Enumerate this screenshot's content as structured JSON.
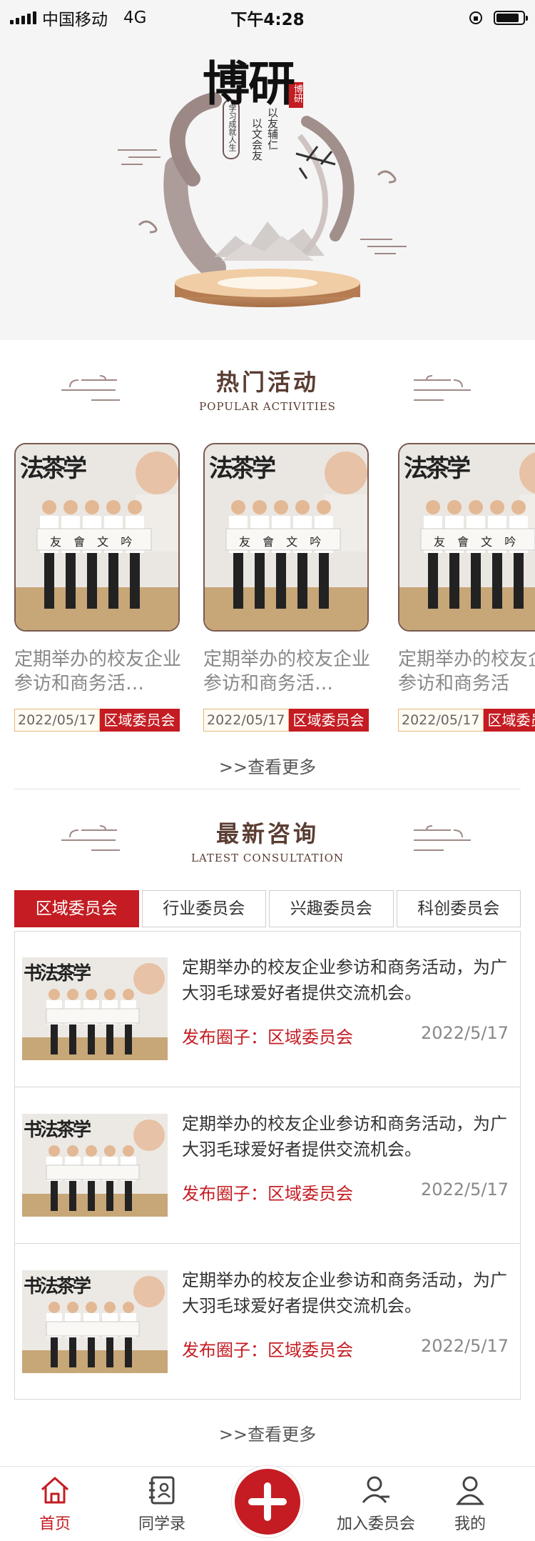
{
  "status_bar": {
    "carrier": "中国移动",
    "network": "4G",
    "time": "下午4:28",
    "battery_level": 0.85
  },
  "hero": {
    "calligraphy_main": "博研",
    "poem_line_1": "以友辅仁",
    "poem_line_2": "以文会友",
    "motto": "学习成就人生",
    "seal": "博研"
  },
  "popular": {
    "title": "热门活动",
    "subtitle": "POPULAR ACTIVITIES",
    "items": [
      {
        "text": "定期举办的校友企业参访和商务活…",
        "date": "2022/05/17",
        "tag": "区域委员会"
      },
      {
        "text": "定期举办的校友企业参访和商务活…",
        "date": "2022/05/17",
        "tag": "区域委员会"
      },
      {
        "text": "定期举办的校友企业参访和商务活",
        "date": "2022/05/17",
        "tag": "区域委员会"
      }
    ],
    "photo_banner_text": "法茶学",
    "photo_sign_text": "友 會 文 吟",
    "more": ">>查看更多"
  },
  "latest": {
    "title": "最新咨询",
    "subtitle": "LATEST CONSULTATION",
    "tabs": [
      "区域委员会",
      "行业委员会",
      "兴趣委员会",
      "科创委员会"
    ],
    "active_tab": 0,
    "photo_banner_text": "书法茶学",
    "items": [
      {
        "text": "定期举办的校友企业参访和商务活动，为广大羽毛球爱好者提供交流机会。",
        "tag": "发布圈子：区域委员会",
        "date": "2022/5/17"
      },
      {
        "text": "定期举办的校友企业参访和商务活动，为广大羽毛球爱好者提供交流机会。",
        "tag": "发布圈子：区域委员会",
        "date": "2022/5/17"
      },
      {
        "text": "定期举办的校友企业参访和商务活动，为广大羽毛球爱好者提供交流机会。",
        "tag": "发布圈子：区域委员会",
        "date": "2022/5/17"
      }
    ],
    "more": ">>查看更多"
  },
  "bottom_nav": {
    "items": [
      {
        "label": "首页",
        "icon": "home-icon",
        "active": true
      },
      {
        "label": "同学录",
        "icon": "contacts-book-icon",
        "active": false
      },
      {
        "label": "",
        "icon": "plus-icon",
        "active": false
      },
      {
        "label": "加入委员会",
        "icon": "join-user-icon",
        "active": false
      },
      {
        "label": "我的",
        "icon": "profile-icon",
        "active": false
      }
    ]
  },
  "colors": {
    "accent_red": "#c41c22",
    "title_brown": "#5a3d33",
    "hero_bg": "#f5f5f5"
  }
}
